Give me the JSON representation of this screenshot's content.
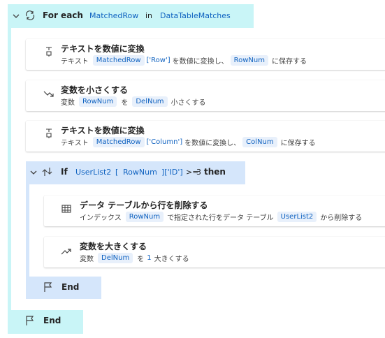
{
  "foreach": {
    "keyword": "For each",
    "item_var": "MatchedRow",
    "in_label": "in",
    "source_var": "DataTableMatches",
    "end_label": "End"
  },
  "actions": [
    {
      "title": "テキストを数値に変換",
      "desc": {
        "prefix": "テキスト",
        "var": "MatchedRow",
        "index": "['Row']",
        "mid": "を数値に変換し、",
        "target": "RowNum",
        "suffix": "に保存する"
      }
    },
    {
      "title": "変数を小さくする",
      "desc": {
        "prefix": "変数",
        "var": "RowNum",
        "mid": "を",
        "target": "DelNum",
        "suffix": "小さくする"
      }
    },
    {
      "title": "テキストを数値に変換",
      "desc": {
        "prefix": "テキスト",
        "var": "MatchedRow",
        "index": "['Column']",
        "mid": "を数値に変換し、",
        "target": "ColNum",
        "suffix": "に保存する"
      }
    }
  ],
  "if_block": {
    "keyword": "If",
    "var": "UserList2",
    "open_bracket": "[",
    "index_var": "RowNum",
    "index_suffix": "]['ID']",
    "operator": ">=",
    "value": "3",
    "then_label": "then",
    "end_label": "End",
    "actions": [
      {
        "title": "データ テーブルから行を削除する",
        "desc": {
          "prefix": "インデックス",
          "var": "RowNum",
          "mid": "で指定された行をデータ テーブル",
          "target": "UserList2",
          "suffix": "から削除する"
        }
      },
      {
        "title": "変数を大きくする",
        "desc": {
          "prefix": "変数",
          "var": "DelNum",
          "mid": "を",
          "value": "1",
          "suffix": "大きくする"
        }
      }
    ]
  },
  "icons": {
    "collapse": "chevron-down-icon",
    "loop": "loop-icon",
    "convert": "text-to-number-icon",
    "decrease": "trend-down-icon",
    "condition": "branch-icon",
    "table": "table-icon",
    "increase": "trend-up-icon",
    "end": "flag-icon"
  },
  "colors": {
    "foreach_bg": "#c9f5f7",
    "if_bg": "#d5e6fb",
    "variable": "#0f62c0",
    "chip_bg": "#e8f0fb"
  }
}
